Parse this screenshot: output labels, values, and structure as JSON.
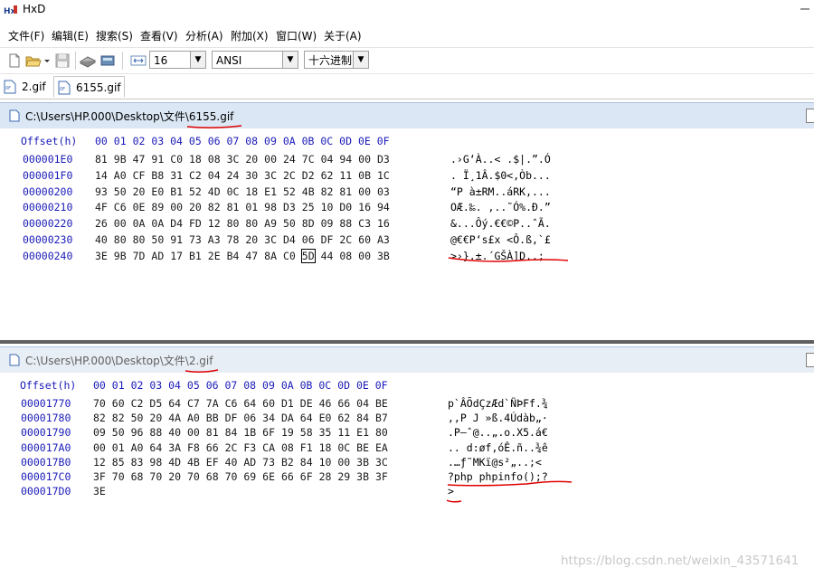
{
  "app": {
    "title": "HxD"
  },
  "menu": [
    "文件(F)",
    "编辑(E)",
    "搜索(S)",
    "查看(V)",
    "分析(A)",
    "附加(X)",
    "窗口(W)",
    "关于(A)"
  ],
  "toolbar": {
    "bytes_per_row": "16",
    "charset": "ANSI",
    "number_base": "十六进制"
  },
  "tabs": [
    {
      "label": "2.gif"
    },
    {
      "label": "6155.gif"
    }
  ],
  "panes": [
    {
      "path_prefix": "C:\\Users\\HP.000\\Desktop\\文件\\",
      "file": "6155.gif",
      "offset_header": "Offset(h)",
      "columns": [
        "00",
        "01",
        "02",
        "03",
        "04",
        "05",
        "06",
        "07",
        "08",
        "09",
        "0A",
        "0B",
        "0C",
        "0D",
        "0E",
        "0F"
      ],
      "rows": [
        {
          "offset": "000001E0",
          "bytes": [
            "81",
            "9B",
            "47",
            "91",
            "C0",
            "18",
            "08",
            "3C",
            "20",
            "00",
            "24",
            "7C",
            "04",
            "94",
            "00",
            "D3"
          ],
          "ascii": ".›G‘À..< .$|.”.Ó"
        },
        {
          "offset": "000001F0",
          "bytes": [
            "14",
            "A0",
            "CF",
            "B8",
            "31",
            "C2",
            "04",
            "24",
            "30",
            "3C",
            "2C",
            "D2",
            "62",
            "11",
            "0B",
            "1C"
          ],
          "ascii": ". Ï¸1Â.$0<,Òb..."
        },
        {
          "offset": "00000200",
          "bytes": [
            "93",
            "50",
            "20",
            "E0",
            "B1",
            "52",
            "4D",
            "0C",
            "18",
            "E1",
            "52",
            "4B",
            "82",
            "81",
            "00",
            "03"
          ],
          "ascii": "“P à±RM..áRK‚..."
        },
        {
          "offset": "00000210",
          "bytes": [
            "4F",
            "C6",
            "0E",
            "89",
            "00",
            "20",
            "82",
            "81",
            "01",
            "98",
            "D3",
            "25",
            "10",
            "D0",
            "16",
            "94"
          ],
          "ascii": "OÆ.‰. ‚..˜Ó%.Ð.”"
        },
        {
          "offset": "00000220",
          "bytes": [
            "26",
            "00",
            "0A",
            "0A",
            "D4",
            "FD",
            "12",
            "80",
            "80",
            "A9",
            "50",
            "8D",
            "09",
            "88",
            "C3",
            "16"
          ],
          "ascii": "&...Ôý.€€©P..ˆÃ."
        },
        {
          "offset": "00000230",
          "bytes": [
            "40",
            "80",
            "80",
            "50",
            "91",
            "73",
            "A3",
            "78",
            "20",
            "3C",
            "D4",
            "06",
            "DF",
            "2C",
            "60",
            "A3"
          ],
          "ascii": "@€€P‘s£x <Ô.ß,`£"
        },
        {
          "offset": "00000240",
          "bytes": [
            "3E",
            "9B",
            "7D",
            "AD",
            "17",
            "B1",
            "2E",
            "B4",
            "47",
            "8A",
            "C0",
            "5D",
            "44",
            "08",
            "00",
            "3B"
          ],
          "ascii": ">›}­.±.´GŠÀ]D..;"
        }
      ]
    },
    {
      "path_prefix": "C:\\Users\\HP.000\\Desktop\\文件\\",
      "file": "2.gif",
      "offset_header": "Offset(h)",
      "columns": [
        "00",
        "01",
        "02",
        "03",
        "04",
        "05",
        "06",
        "07",
        "08",
        "09",
        "0A",
        "0B",
        "0C",
        "0D",
        "0E",
        "0F"
      ],
      "rows": [
        {
          "offset": "00001770",
          "bytes": [
            "70",
            "60",
            "C2",
            "D5",
            "64",
            "C7",
            "7A",
            "C6",
            "64",
            "60",
            "D1",
            "DE",
            "46",
            "66",
            "04",
            "BE"
          ],
          "ascii": "p`ÂÕdÇzÆd`ÑÞFf.¾"
        },
        {
          "offset": "00001780",
          "bytes": [
            "82",
            "82",
            "50",
            "20",
            "4A",
            "A0",
            "BB",
            "DF",
            "06",
            "34",
            "DA",
            "64",
            "E0",
            "62",
            "84",
            "B7"
          ],
          "ascii": "‚‚P J »ß.4Údàb„·"
        },
        {
          "offset": "00001790",
          "bytes": [
            "09",
            "50",
            "96",
            "88",
            "40",
            "00",
            "81",
            "84",
            "1B",
            "6F",
            "19",
            "58",
            "35",
            "11",
            "E1",
            "80"
          ],
          "ascii": ".P–ˆ@..„.o.X5.á€"
        },
        {
          "offset": "000017A0",
          "bytes": [
            "00",
            "01",
            "A0",
            "64",
            "3A",
            "F8",
            "66",
            "2C",
            "F3",
            "CA",
            "08",
            "F1",
            "18",
            "0C",
            "BE",
            "EA"
          ],
          "ascii": ".. d:øf,óÊ.ñ..¾ê"
        },
        {
          "offset": "000017B0",
          "bytes": [
            "12",
            "85",
            "83",
            "98",
            "4D",
            "4B",
            "EF",
            "40",
            "AD",
            "73",
            "B2",
            "84",
            "10",
            "00",
            "3B",
            "3C"
          ],
          "ascii": ".…ƒ˜MKï@­s²„..;<"
        },
        {
          "offset": "000017C0",
          "bytes": [
            "3F",
            "70",
            "68",
            "70",
            "20",
            "70",
            "68",
            "70",
            "69",
            "6E",
            "66",
            "6F",
            "28",
            "29",
            "3B",
            "3F"
          ],
          "ascii": "?php phpinfo();?"
        },
        {
          "offset": "000017D0",
          "bytes": [
            "3E"
          ],
          "ascii": ">"
        }
      ]
    }
  ],
  "watermark": "https://blog.csdn.net/weixin_43571641"
}
